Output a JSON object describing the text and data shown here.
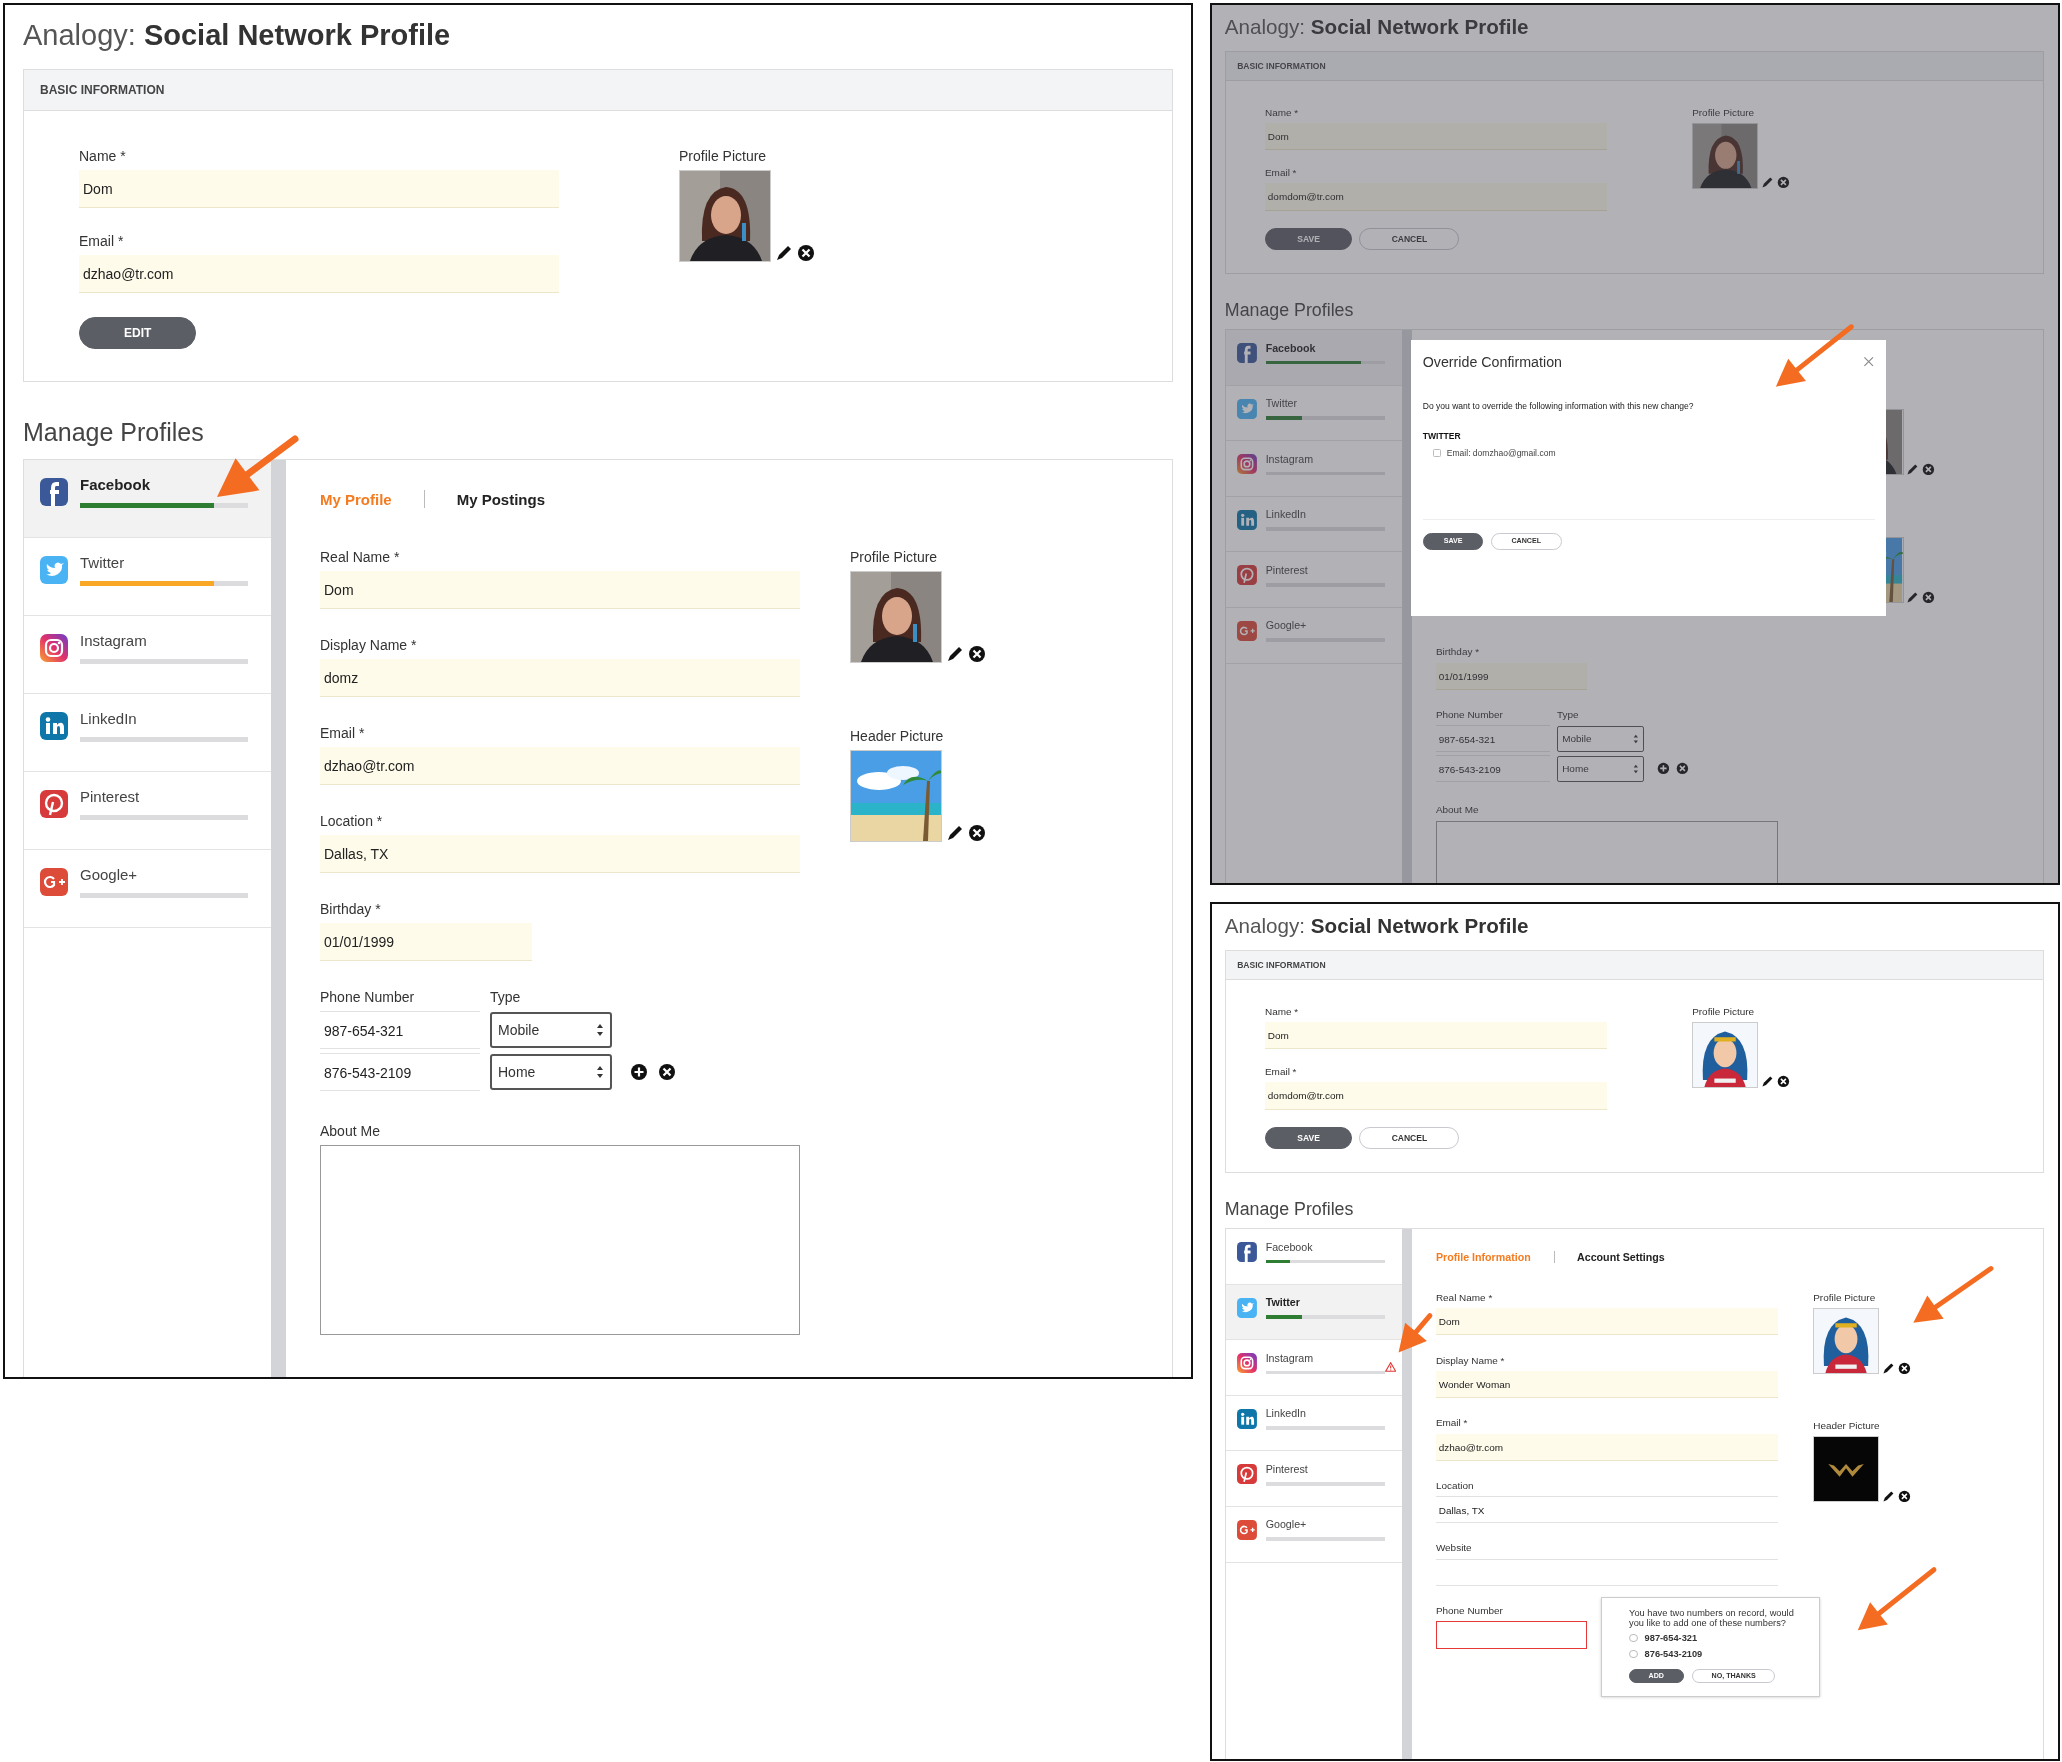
{
  "panels": [
    {
      "heading": {
        "prefix": "Analogy:",
        "title": "Social Network Profile"
      },
      "basic": {
        "heading": "BASIC INFORMATION",
        "fields": [
          {
            "label": "Name *",
            "value": "Dom"
          },
          {
            "label": "Email *",
            "value": "dzhao@tr.com"
          }
        ],
        "picture": {
          "label": "Profile Picture",
          "kind": "picture"
        },
        "buttons": [
          {
            "label": "EDIT",
            "kind": "primary"
          }
        ]
      },
      "manage_heading": "Manage Profiles",
      "networks": [
        {
          "name": "Facebook",
          "selected": true,
          "level": 0.8,
          "color": "#2e7d32"
        },
        {
          "name": "Twitter",
          "selected": false,
          "level": 0.8,
          "color": "#f9a825"
        },
        {
          "name": "Instagram",
          "selected": false,
          "level": 0
        },
        {
          "name": "LinkedIn",
          "selected": false,
          "level": 0
        },
        {
          "name": "Pinterest",
          "selected": false,
          "level": 0
        },
        {
          "name": "Google+",
          "selected": false,
          "level": 0
        }
      ],
      "tabs": [
        {
          "label": "My Profile",
          "selected": true
        },
        {
          "label": "My Postings",
          "selected": false
        }
      ],
      "fields": [
        {
          "kind": "text",
          "label": "Real Name *",
          "value": "Dom",
          "required": true
        },
        {
          "kind": "text",
          "label": "Display Name *",
          "value": "domz",
          "required": true
        },
        {
          "kind": "text",
          "label": "Email *",
          "value": "dzhao@tr.com",
          "required": true
        },
        {
          "kind": "text",
          "label": "Location *",
          "value": "Dallas, TX",
          "required": true
        },
        {
          "kind": "short",
          "label": "Birthday *",
          "value": "01/01/1999",
          "required": true
        },
        {
          "kind": "phone",
          "label": "Phone Number",
          "type_label": "Type",
          "rows": [
            {
              "number": "987-654-321",
              "type": "Mobile"
            },
            {
              "number": "876-543-2109",
              "type": "Home"
            }
          ]
        },
        {
          "kind": "textarea",
          "label": "About Me"
        }
      ],
      "pictures": [
        {
          "label": "Profile Picture",
          "kind": "picture"
        },
        {
          "label": "Header Picture",
          "kind": "picture"
        }
      ],
      "arrows": [
        {
          "kind": "sidebar"
        }
      ]
    },
    {
      "heading": {
        "prefix": "Analogy:",
        "title": "Social Network Profile"
      },
      "basic": {
        "heading": "BASIC INFORMATION",
        "fields": [
          {
            "label": "Name *",
            "value": "Dom"
          },
          {
            "label": "Email *",
            "value": "domdom@tr.com"
          }
        ],
        "picture": {
          "label": "Profile Picture",
          "kind": "picture"
        },
        "buttons": [
          {
            "label": "SAVE",
            "kind": "primary"
          },
          {
            "label": "CANCEL",
            "kind": "secondary"
          }
        ]
      },
      "manage_heading": "Manage Profiles",
      "networks": [
        {
          "name": "Facebook",
          "selected": true,
          "level": 0.8
        },
        {
          "name": "Twitter",
          "selected": false,
          "level": 0.3
        },
        {
          "name": "Instagram",
          "selected": false,
          "level": 0
        },
        {
          "name": "LinkedIn",
          "selected": false,
          "level": 0
        },
        {
          "name": "Pinterest",
          "selected": false,
          "level": 0
        },
        {
          "name": "Google+",
          "selected": false,
          "level": 0
        }
      ],
      "fields": [
        {
          "kind": "short",
          "label": "Birthday *",
          "value": "01/01/1999",
          "required": true
        },
        {
          "kind": "phone",
          "label": "Phone Number",
          "type_label": "Type",
          "rows": [
            {
              "number": "987-654-321",
              "type": "Mobile"
            },
            {
              "number": "876-543-2109",
              "type": "Home"
            }
          ]
        },
        {
          "kind": "textarea",
          "label": "About Me"
        }
      ],
      "pictures": [
        {
          "kind": "picture"
        },
        {
          "kind": "picture"
        }
      ],
      "dialog": {
        "title": "Override Confirmation",
        "question": "Do you want to override the following information with this new change?",
        "section": "TWITTER",
        "options": [
          {
            "label": "Email: domzhao@gmail.com",
            "checked": false
          }
        ],
        "buttons": [
          {
            "label": "SAVE",
            "kind": "primary"
          },
          {
            "label": "CANCEL",
            "kind": "secondary"
          }
        ]
      },
      "arrows": [
        {
          "kind": "dialog"
        }
      ]
    },
    {
      "heading": {
        "prefix": "Analogy:",
        "title": "Social Network Profile"
      },
      "basic": {
        "heading": "BASIC INFORMATION",
        "fields": [
          {
            "label": "Name *",
            "value": "Dom"
          },
          {
            "label": "Email *",
            "value": "domdom@tr.com"
          }
        ],
        "picture": {
          "label": "Profile Picture",
          "kind": "picture"
        },
        "buttons": [
          {
            "label": "SAVE",
            "kind": "primary"
          },
          {
            "label": "CANCEL",
            "kind": "secondary"
          }
        ]
      },
      "manage_heading": "Manage Profiles",
      "networks": [
        {
          "name": "Facebook",
          "selected": false,
          "level": 0.2,
          "color": "#2e7d32",
          "warning": false
        },
        {
          "name": "Twitter",
          "selected": true,
          "level": 0.3,
          "color": "#2e7d32",
          "warning": false
        },
        {
          "name": "Instagram",
          "selected": false,
          "level": 0,
          "warning": true
        },
        {
          "name": "LinkedIn",
          "selected": false,
          "level": 0,
          "warning": false
        },
        {
          "name": "Pinterest",
          "selected": false,
          "level": 0,
          "warning": false
        },
        {
          "name": "Google+",
          "selected": false,
          "level": 0,
          "warning": false
        }
      ],
      "tabs": [
        {
          "label": "Profile Information",
          "selected": true
        },
        {
          "label": "Account Settings",
          "selected": false
        }
      ],
      "fields": [
        {
          "kind": "text",
          "label": "Real Name *",
          "value": "Dom",
          "required": true
        },
        {
          "kind": "text",
          "label": "Display Name *",
          "value": "Wonder Woman",
          "required": true
        },
        {
          "kind": "text",
          "label": "Email *",
          "value": "dzhao@tr.com",
          "required": true
        },
        {
          "kind": "text",
          "label": "Location",
          "value": "Dallas, TX",
          "required": false
        },
        {
          "kind": "text",
          "label": "Website",
          "required": false
        },
        {
          "kind": "short",
          "label": "Phone Number",
          "required": false,
          "invalid": true,
          "suggestion": {
            "message": "You have two numbers on record, would you like to add one of these numbers?",
            "options": [
              {
                "label": "987-654-321",
                "selected": false
              },
              {
                "label": "876-543-2109",
                "selected": false
              }
            ],
            "buttons": [
              {
                "label": "ADD",
                "kind": "primary"
              },
              {
                "label": "NO, THANKS",
                "kind": "secondary"
              }
            ]
          }
        }
      ],
      "pictures": [
        {
          "label": "Profile Picture",
          "kind": "picture"
        },
        {
          "label": "Header Picture",
          "kind": "picture"
        }
      ],
      "arrows": [
        {
          "kind": "sidebar-warning"
        },
        {
          "kind": "picture"
        },
        {
          "kind": "popover"
        }
      ]
    }
  ]
}
